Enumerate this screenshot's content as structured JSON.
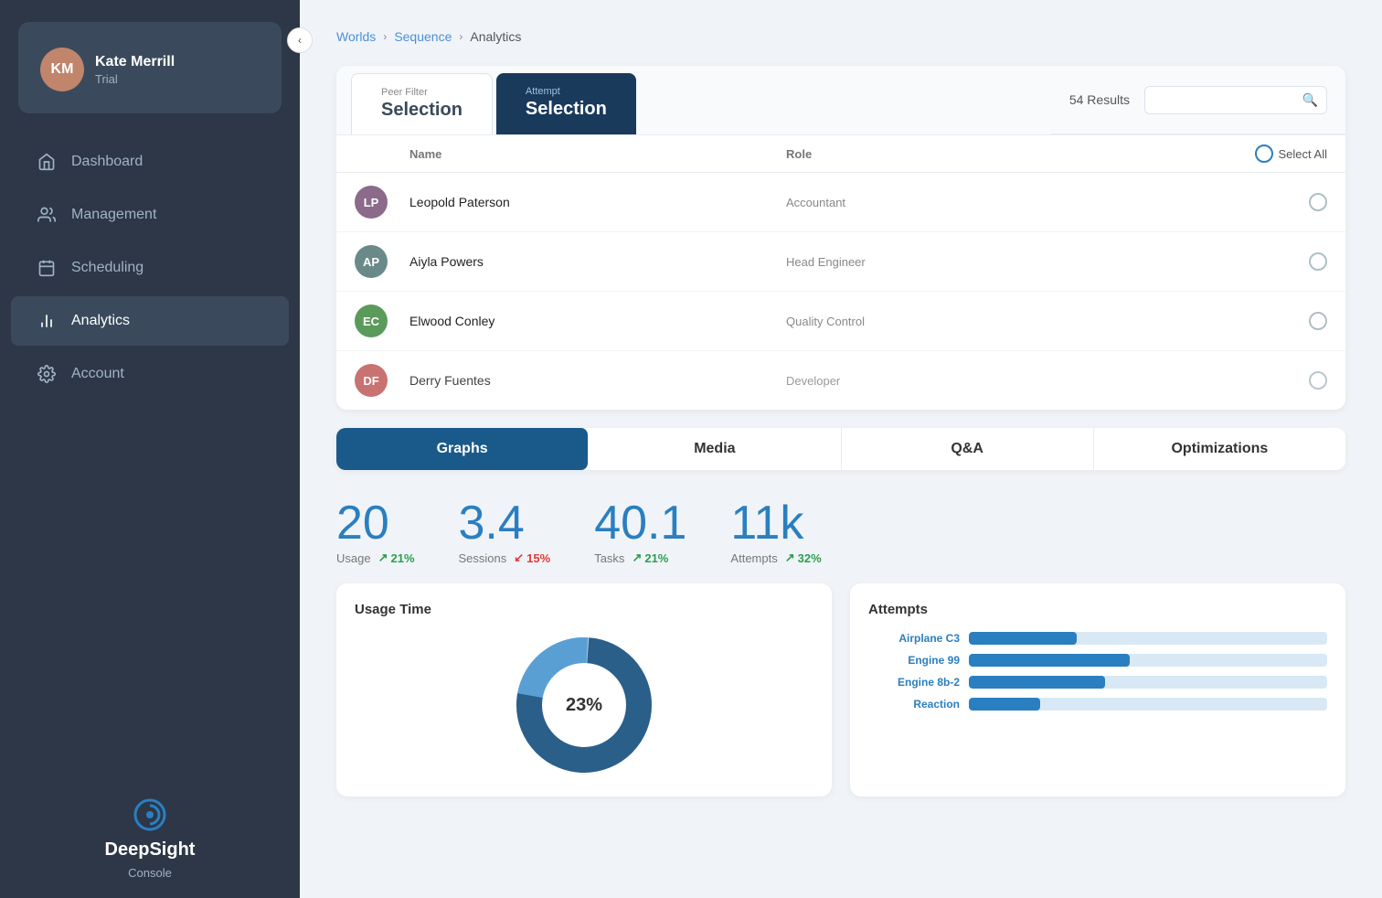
{
  "sidebar": {
    "collapse_btn": "‹",
    "user": {
      "initials": "KM",
      "name": "Kate Merrill",
      "plan": "Trial"
    },
    "nav_items": [
      {
        "id": "dashboard",
        "label": "Dashboard",
        "icon": "home",
        "active": false
      },
      {
        "id": "management",
        "label": "Management",
        "icon": "users",
        "active": false
      },
      {
        "id": "scheduling",
        "label": "Scheduling",
        "icon": "calendar",
        "active": false
      },
      {
        "id": "analytics",
        "label": "Analytics",
        "icon": "chart",
        "active": true
      },
      {
        "id": "account",
        "label": "Account",
        "icon": "gear",
        "active": false
      }
    ],
    "logo": {
      "name": "DeepSight",
      "sub": "Console"
    }
  },
  "breadcrumb": {
    "items": [
      "Worlds",
      "Sequence",
      "Analytics"
    ]
  },
  "peer_filter": {
    "tab_inactive_small": "Peer Filter",
    "tab_inactive_main": "Selection",
    "tab_active_small": "Attempt",
    "tab_active_main": "Selection",
    "results_count": "54 Results",
    "search_placeholder": "",
    "table_headers": [
      "",
      "Name",
      "Role",
      "",
      "Select All"
    ],
    "rows": [
      {
        "initials": "LP",
        "name": "Leopold Paterson",
        "role": "Accountant",
        "color": "#8b6a8a"
      },
      {
        "initials": "AP",
        "name": "Aiyla Powers",
        "role": "Head Engineer",
        "color": "#6a8a8a"
      },
      {
        "initials": "EC",
        "name": "Elwood Conley",
        "role": "Quality Control",
        "color": "#5a9a5a"
      },
      {
        "initials": "DF",
        "name": "Derry Fuentes",
        "role": "Developer",
        "color": "#c05a5a"
      }
    ]
  },
  "content_tabs": {
    "items": [
      "Graphs",
      "Media",
      "Q&A",
      "Optimizations"
    ],
    "active": "Graphs"
  },
  "stats": [
    {
      "value": "20",
      "label": "Usage",
      "change": "21%",
      "dir": "up"
    },
    {
      "value": "3.4",
      "label": "Sessions",
      "change": "15%",
      "dir": "down"
    },
    {
      "value": "40.1",
      "label": "Tasks",
      "change": "21%",
      "dir": "up"
    },
    {
      "value": "11k",
      "label": "Attempts",
      "change": "32%",
      "dir": "up"
    }
  ],
  "charts": {
    "usage_time": {
      "title": "Usage Time",
      "donut_label": "23%"
    },
    "attempts": {
      "title": "Attempts",
      "bars": [
        {
          "label": "Airplane C3",
          "pct": 30
        },
        {
          "label": "Engine 99",
          "pct": 45
        },
        {
          "label": "Engine 8b-2",
          "pct": 38
        },
        {
          "label": "Reaction",
          "pct": 20
        }
      ]
    }
  },
  "colors": {
    "accent": "#2a7fc0",
    "sidebar_bg": "#2d3748",
    "sidebar_active": "#3a4a5c",
    "stat_blue": "#2a7fc0",
    "up_green": "#2e9e4e",
    "down_red": "#e53935",
    "tab_active_bg": "#1a3a5c"
  }
}
